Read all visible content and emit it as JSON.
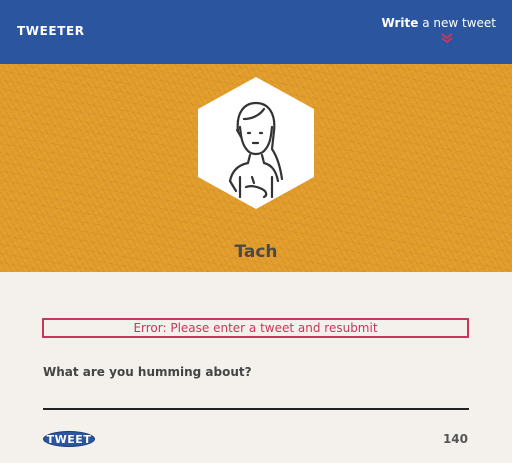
{
  "header": {
    "logo": "TWEETER",
    "compose_bold": "Write",
    "compose_rest": " a new tweet",
    "compose_icon": "chevron-down-icon",
    "background": "#2c55a0"
  },
  "profile": {
    "name": "Tach",
    "avatar_icon": "person-avatar-icon",
    "background": "#e39d2b"
  },
  "form": {
    "error": "Error: Please enter a tweet and resubmit",
    "label": "What are you humming about?",
    "input_value": "",
    "submit_label": "TWEET",
    "char_count": "140",
    "error_color": "#c8375a"
  }
}
